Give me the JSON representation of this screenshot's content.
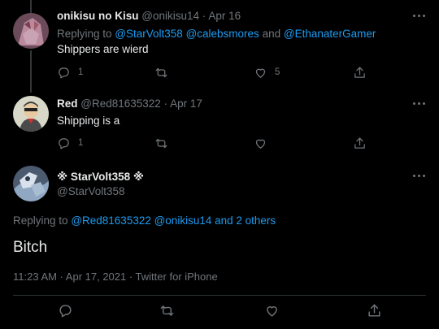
{
  "tweets": [
    {
      "name": "onikisu no Kisu",
      "handle": "@onikisu14",
      "date": "Apr 16",
      "replying_prefix": "Replying to",
      "replying_mentions": "@StarVolt358 @calebsmores",
      "replying_and": "and",
      "replying_last": "@EthanaterGamer",
      "text": "Shippers are wierd",
      "reply_count": "1",
      "retweet_count": "",
      "like_count": "5"
    },
    {
      "name": "Red",
      "handle": "@Red81635322",
      "date": "Apr 17",
      "text": "Shipping is a",
      "reply_count": "1",
      "retweet_count": "",
      "like_count": ""
    }
  ],
  "main_tweet": {
    "name": "※ StarVolt358 ※",
    "handle": "@StarVolt358",
    "replying_prefix": "Replying to",
    "replying_mentions": "@Red81635322 @onikisu14",
    "replying_and": "and 2 others",
    "text": "Bitch",
    "meta": "11:23 AM · Apr 17, 2021 · Twitter for iPhone"
  },
  "separator": "·",
  "icons": [
    "more-icon",
    "reply-icon",
    "retweet-icon",
    "like-icon",
    "share-icon"
  ],
  "colors": {
    "background": "#000000",
    "text": "#e7e9ea",
    "muted": "#71767b",
    "link": "#1d9bf0",
    "divider": "#2f3336"
  }
}
